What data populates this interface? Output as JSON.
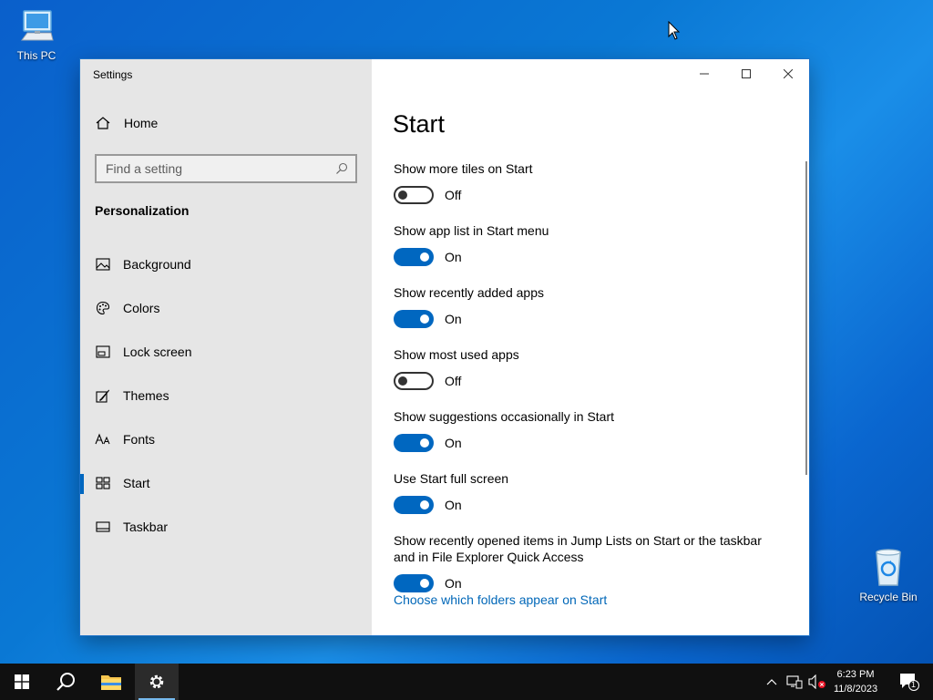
{
  "desktop": {
    "icons": [
      {
        "label": "This PC"
      },
      {
        "label": "Recycle Bin"
      }
    ]
  },
  "window": {
    "title": "Settings",
    "controls": {
      "minimize": "minimize-icon",
      "maximize": "maximize-icon",
      "close": "close-icon"
    }
  },
  "sidebar": {
    "home_label": "Home",
    "search_placeholder": "Find a setting",
    "section_title": "Personalization",
    "items": [
      {
        "label": "Background",
        "icon": "picture-icon"
      },
      {
        "label": "Colors",
        "icon": "palette-icon"
      },
      {
        "label": "Lock screen",
        "icon": "lock-screen-icon"
      },
      {
        "label": "Themes",
        "icon": "brush-icon"
      },
      {
        "label": "Fonts",
        "icon": "fonts-icon"
      },
      {
        "label": "Start",
        "icon": "start-tiles-icon",
        "active": true
      },
      {
        "label": "Taskbar",
        "icon": "taskbar-icon"
      }
    ]
  },
  "content": {
    "page_title": "Start",
    "settings": [
      {
        "label": "Show more tiles on Start",
        "state": "Off",
        "on": false
      },
      {
        "label": "Show app list in Start menu",
        "state": "On",
        "on": true
      },
      {
        "label": "Show recently added apps",
        "state": "On",
        "on": true
      },
      {
        "label": "Show most used apps",
        "state": "Off",
        "on": false
      },
      {
        "label": "Show suggestions occasionally in Start",
        "state": "On",
        "on": true
      },
      {
        "label": "Use Start full screen",
        "state": "On",
        "on": true
      },
      {
        "label": "Show recently opened items in Jump Lists on Start or the taskbar and in File Explorer Quick Access",
        "state": "On",
        "on": true
      }
    ],
    "link": "Choose which folders appear on Start"
  },
  "taskbar": {
    "time": "6:23 PM",
    "date": "11/8/2023",
    "notification_count": "1"
  },
  "colors": {
    "accent": "#0067c0",
    "sidebar_bg": "#e6e6e6",
    "taskbar_bg": "#101010"
  }
}
